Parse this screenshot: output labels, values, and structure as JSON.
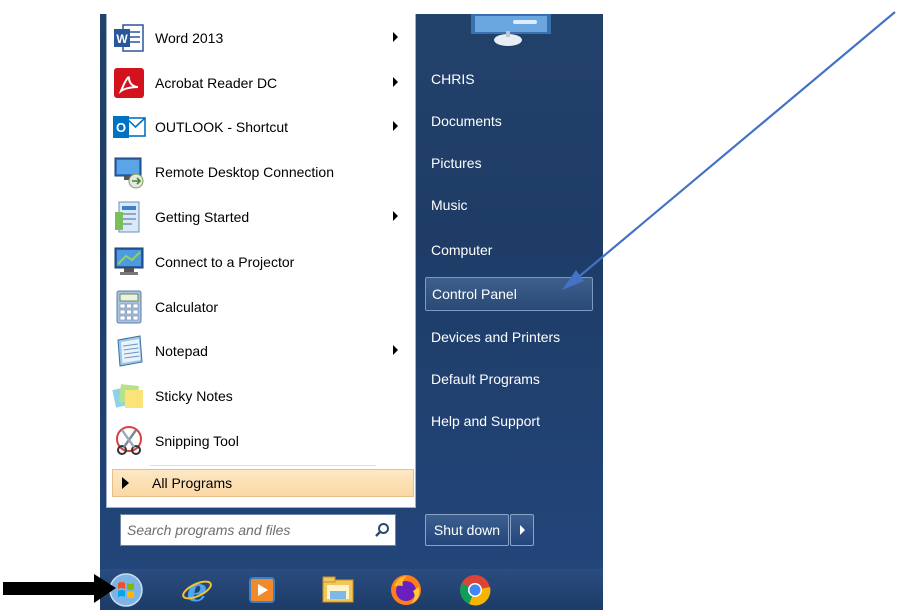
{
  "programs": [
    {
      "label": "Word 2013",
      "icon": "word-icon",
      "has_submenu": true
    },
    {
      "label": "Acrobat Reader DC",
      "icon": "acrobat-icon",
      "has_submenu": true
    },
    {
      "label": "OUTLOOK - Shortcut",
      "icon": "outlook-icon",
      "has_submenu": true
    },
    {
      "label": "Remote Desktop Connection",
      "icon": "remote-desktop-icon",
      "has_submenu": false
    },
    {
      "label": "Getting Started",
      "icon": "getting-started-icon",
      "has_submenu": true
    },
    {
      "label": "Connect to a Projector",
      "icon": "projector-icon",
      "has_submenu": false
    },
    {
      "label": "Calculator",
      "icon": "calculator-icon",
      "has_submenu": false
    },
    {
      "label": "Notepad",
      "icon": "notepad-icon",
      "has_submenu": true
    },
    {
      "label": "Sticky Notes",
      "icon": "sticky-notes-icon",
      "has_submenu": false
    },
    {
      "label": "Snipping Tool",
      "icon": "snipping-tool-icon",
      "has_submenu": false
    }
  ],
  "all_programs_label": "All Programs",
  "search": {
    "placeholder": "Search programs and files"
  },
  "right_menu": {
    "user": "CHRIS",
    "documents": "Documents",
    "pictures": "Pictures",
    "music": "Music",
    "computer": "Computer",
    "control_panel": "Control Panel",
    "devices_printers": "Devices and Printers",
    "default_programs": "Default Programs",
    "help_support": "Help and Support"
  },
  "shutdown_label": "Shut down",
  "taskbar_icons": [
    "start-orb-icon",
    "internet-explorer-icon",
    "media-player-icon",
    "file-explorer-icon",
    "firefox-icon",
    "chrome-icon"
  ],
  "colors": {
    "annotation_arrow": "#4472c4",
    "menu_blue": "#1f3d68",
    "highlight": "#fbd8a4"
  }
}
